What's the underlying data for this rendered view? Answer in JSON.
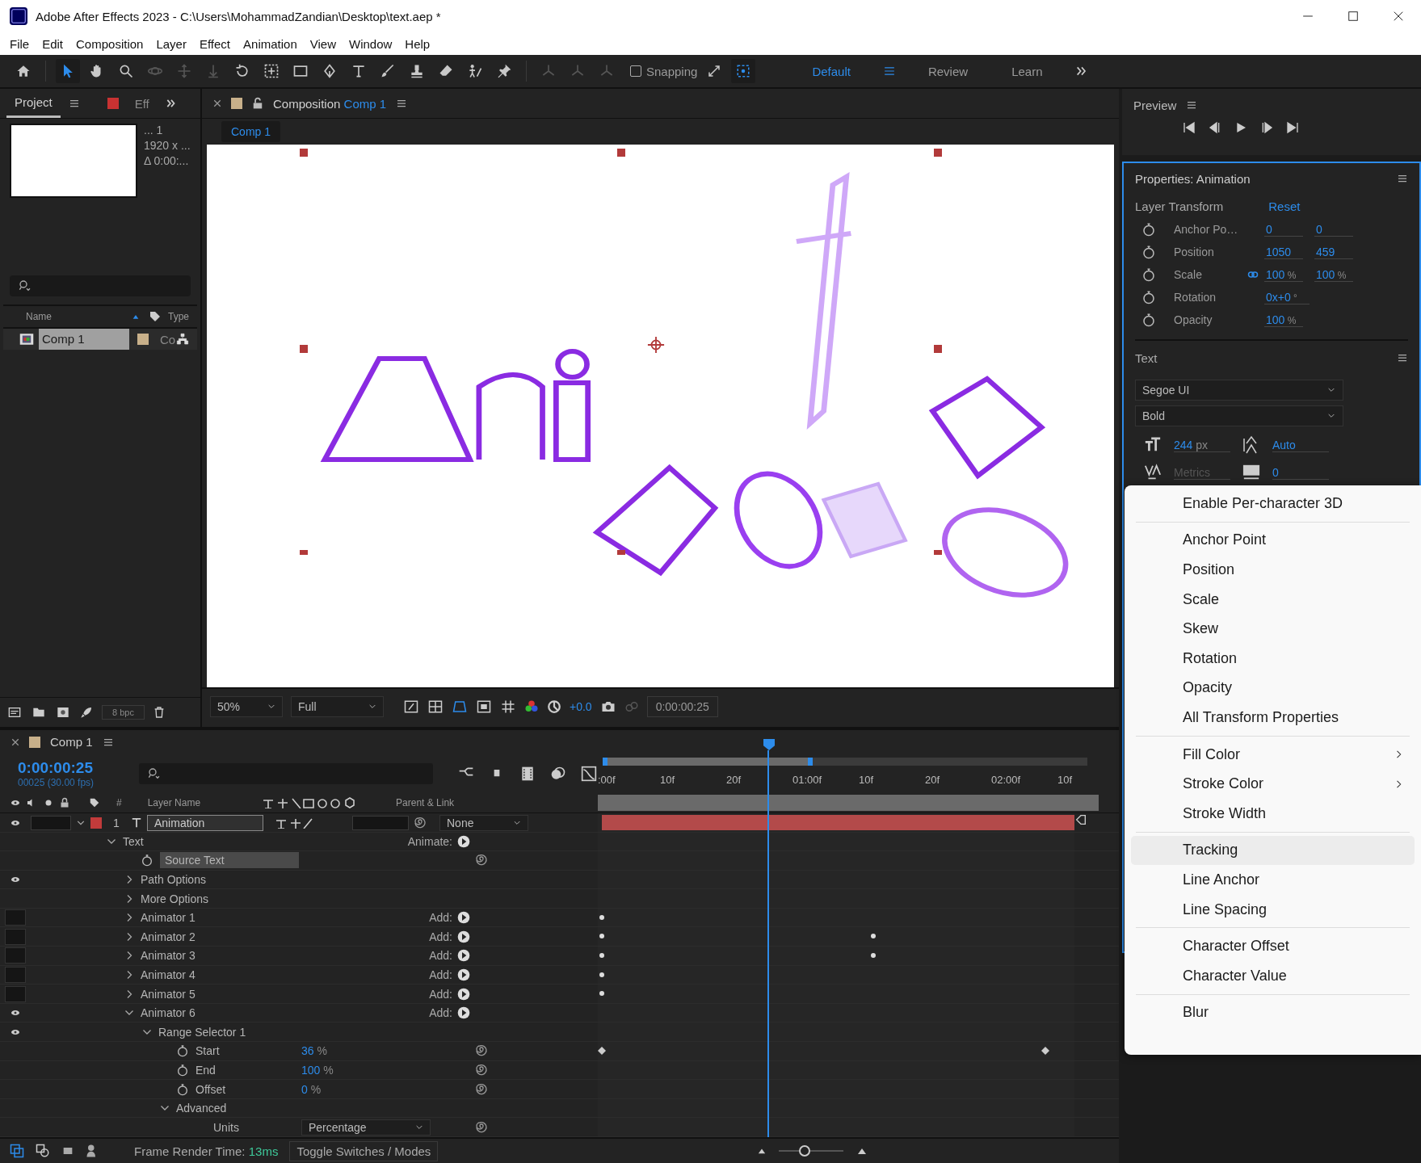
{
  "window": {
    "title": "Adobe After Effects 2023 - C:\\Users\\MohammadZandian\\Desktop\\text.aep *"
  },
  "menu_bar": [
    "File",
    "Edit",
    "Composition",
    "Layer",
    "Effect",
    "Animation",
    "View",
    "Window",
    "Help"
  ],
  "toolbar": {
    "tools": [
      {
        "kind": "home",
        "selected": false,
        "disabled": false
      },
      {
        "kind": "select",
        "selected": true,
        "disabled": false
      },
      {
        "kind": "hand",
        "selected": false,
        "disabled": false
      },
      {
        "kind": "zoom",
        "selected": false,
        "disabled": false
      },
      {
        "kind": "orbit",
        "selected": false,
        "disabled": true
      },
      {
        "kind": "pan",
        "selected": false,
        "disabled": true
      },
      {
        "kind": "dolly",
        "selected": false,
        "disabled": true
      },
      {
        "kind": "rotate",
        "selected": false,
        "disabled": false
      },
      {
        "kind": "anchor",
        "selected": false,
        "disabled": false
      },
      {
        "kind": "rect",
        "selected": false,
        "disabled": false
      },
      {
        "kind": "pen",
        "selected": false,
        "disabled": false
      },
      {
        "kind": "type",
        "selected": false,
        "disabled": false
      },
      {
        "kind": "brush",
        "selected": false,
        "disabled": false
      },
      {
        "kind": "stamp",
        "selected": false,
        "disabled": false
      },
      {
        "kind": "eraser",
        "selected": false,
        "disabled": false
      },
      {
        "kind": "roto",
        "selected": false,
        "disabled": false
      },
      {
        "kind": "pin",
        "selected": false,
        "disabled": false
      },
      {
        "kind": "axis",
        "selected": false,
        "disabled": true
      },
      {
        "kind": "axis",
        "selected": false,
        "disabled": true
      },
      {
        "kind": "axis",
        "selected": false,
        "disabled": true
      }
    ],
    "snapping": {
      "label": "Snapping",
      "checked": false
    },
    "workspaces": [
      {
        "label": "Default",
        "selected": true
      },
      {
        "label": "Review",
        "selected": false
      },
      {
        "label": "Learn",
        "selected": false
      }
    ]
  },
  "project_panel": {
    "tabs": [
      {
        "label": "Project",
        "selected": true
      },
      {
        "label": "Eff",
        "selected": false
      }
    ],
    "info": [
      "... 1",
      "1920 x ...",
      "Δ 0:00:..."
    ],
    "columns": [
      "Name",
      "Type"
    ],
    "items": [
      {
        "name": "Comp 1",
        "type": "Co",
        "selected": true
      }
    ],
    "bit_depth": "8 bpc"
  },
  "composition_panel": {
    "tab_label": "Composition",
    "tab_name": "Comp 1",
    "breadcrumb": "Comp 1",
    "zoom": "50%",
    "resolution": "Full",
    "exposure": "+0.0",
    "timecode": "0:00:00:25"
  },
  "preview_panel": {
    "title": "Preview"
  },
  "properties_panel": {
    "title": "Properties:",
    "layer": "Animation",
    "section": "Layer Transform",
    "reset": "Reset",
    "transform": [
      {
        "name": "Anchor Po…",
        "values": [
          "0",
          "0"
        ],
        "linked": false
      },
      {
        "name": "Position",
        "values": [
          "1050",
          "459"
        ],
        "linked": false
      },
      {
        "name": "Scale",
        "values": [
          "100",
          "100"
        ],
        "unit": "%",
        "linked": true
      },
      {
        "name": "Rotation",
        "values": [
          "0x+0"
        ],
        "unit": "°",
        "linked": false
      },
      {
        "name": "Opacity",
        "values": [
          "100"
        ],
        "unit": "%",
        "linked": false
      }
    ],
    "text_section": "Text",
    "font": "Segoe UI",
    "style": "Bold",
    "font_size": "244",
    "font_size_unit": "px",
    "leading": "Auto",
    "kerning": "Metrics",
    "tracking": "0"
  },
  "context_menu": [
    {
      "kind": "item",
      "label": "Enable Per-character 3D",
      "submenu": false,
      "selected": false
    },
    {
      "kind": "separator"
    },
    {
      "kind": "item",
      "label": "Anchor Point",
      "submenu": false,
      "selected": false
    },
    {
      "kind": "item",
      "label": "Position",
      "submenu": false,
      "selected": false
    },
    {
      "kind": "item",
      "label": "Scale",
      "submenu": false,
      "selected": false
    },
    {
      "kind": "item",
      "label": "Skew",
      "submenu": false,
      "selected": false
    },
    {
      "kind": "item",
      "label": "Rotation",
      "submenu": false,
      "selected": false
    },
    {
      "kind": "item",
      "label": "Opacity",
      "submenu": false,
      "selected": false
    },
    {
      "kind": "item",
      "label": "All Transform Properties",
      "submenu": false,
      "selected": false
    },
    {
      "kind": "separator"
    },
    {
      "kind": "item",
      "label": "Fill Color",
      "submenu": true,
      "selected": false
    },
    {
      "kind": "item",
      "label": "Stroke Color",
      "submenu": true,
      "selected": false
    },
    {
      "kind": "item",
      "label": "Stroke Width",
      "submenu": false,
      "selected": false
    },
    {
      "kind": "separator"
    },
    {
      "kind": "item",
      "label": "Tracking",
      "submenu": false,
      "selected": true
    },
    {
      "kind": "item",
      "label": "Line Anchor",
      "submenu": false,
      "selected": false
    },
    {
      "kind": "item",
      "label": "Line Spacing",
      "submenu": false,
      "selected": false
    },
    {
      "kind": "separator"
    },
    {
      "kind": "item",
      "label": "Character Offset",
      "submenu": false,
      "selected": false
    },
    {
      "kind": "item",
      "label": "Character Value",
      "submenu": false,
      "selected": false
    },
    {
      "kind": "separator"
    },
    {
      "kind": "item",
      "label": "Blur",
      "submenu": false,
      "selected": false
    }
  ],
  "timeline": {
    "tab": "Comp 1",
    "timecode": "0:00:00:25",
    "frame_info": "00025 (30.00 fps)",
    "ruler": [
      ":00f",
      "10f",
      "20f",
      "01:00f",
      "10f",
      "20f",
      "02:00f",
      "10f"
    ],
    "columns": [
      "#",
      "Layer Name",
      "Parent & Link"
    ],
    "layer": {
      "number": "1",
      "name": "Animation",
      "parent": "None",
      "color": "#c23b3b",
      "expanded": true,
      "visible": true
    },
    "properties": [
      {
        "kind": "group",
        "label": "Text",
        "expanded": true,
        "selected": false,
        "action": "Animate:",
        "children": [
          {
            "kind": "property",
            "label": "Source Text",
            "selected": true
          },
          {
            "kind": "group",
            "label": "Path Options",
            "expanded": false,
            "visible": true,
            "selected": false
          },
          {
            "kind": "group",
            "label": "More Options",
            "expanded": false,
            "selected": false
          },
          {
            "kind": "group",
            "label": "Animator 1",
            "expanded": false,
            "visible": false,
            "selected": false,
            "action": "Add:",
            "keyframes": [
              {
                "level": 0
              }
            ]
          },
          {
            "kind": "group",
            "label": "Animator 2",
            "expanded": false,
            "visible": false,
            "selected": false,
            "action": "Add:",
            "keyframes": [
              {
                "level": 0
              },
              {
                "level": 0.6
              }
            ]
          },
          {
            "kind": "group",
            "label": "Animator 3",
            "expanded": false,
            "visible": false,
            "selected": false,
            "action": "Add:",
            "keyframes": [
              {
                "level": 0
              },
              {
                "level": 0.6
              }
            ]
          },
          {
            "kind": "group",
            "label": "Animator 4",
            "expanded": false,
            "visible": false,
            "selected": false,
            "action": "Add:",
            "keyframes": [
              {
                "level": 0
              }
            ]
          },
          {
            "kind": "group",
            "label": "Animator 5",
            "expanded": false,
            "visible": false,
            "selected": false,
            "action": "Add:",
            "keyframes": [
              {
                "level": 0
              }
            ]
          },
          {
            "kind": "group",
            "label": "Animator 6",
            "expanded": true,
            "visible": true,
            "selected": false,
            "action": "Add:",
            "children": [
              {
                "kind": "group",
                "label": "Range Selector 1",
                "expanded": true,
                "visible": true,
                "selected": false,
                "children": [
                  {
                    "kind": "property",
                    "label": "Start",
                    "value": "36",
                    "unit": "%",
                    "selected": false,
                    "keyframes": [
                      {
                        "level": 0
                      },
                      {
                        "level": 0.98
                      }
                    ]
                  },
                  {
                    "kind": "property",
                    "label": "End",
                    "value": "100",
                    "unit": "%",
                    "selected": false
                  },
                  {
                    "kind": "property",
                    "label": "Offset",
                    "value": "0",
                    "unit": "%",
                    "selected": false
                  },
                  {
                    "kind": "group",
                    "label": "Advanced",
                    "expanded": true,
                    "selected": false,
                    "children": [
                      {
                        "kind": "dropdown",
                        "label": "Units",
                        "value": "Percentage",
                        "selected": false
                      }
                    ]
                  }
                ]
              }
            ]
          }
        ]
      }
    ],
    "zoom_slider": {
      "level": 0.4
    },
    "status": {
      "label": "Frame Render Time:",
      "value": "13ms",
      "toggle": "Toggle Switches / Modes"
    }
  }
}
